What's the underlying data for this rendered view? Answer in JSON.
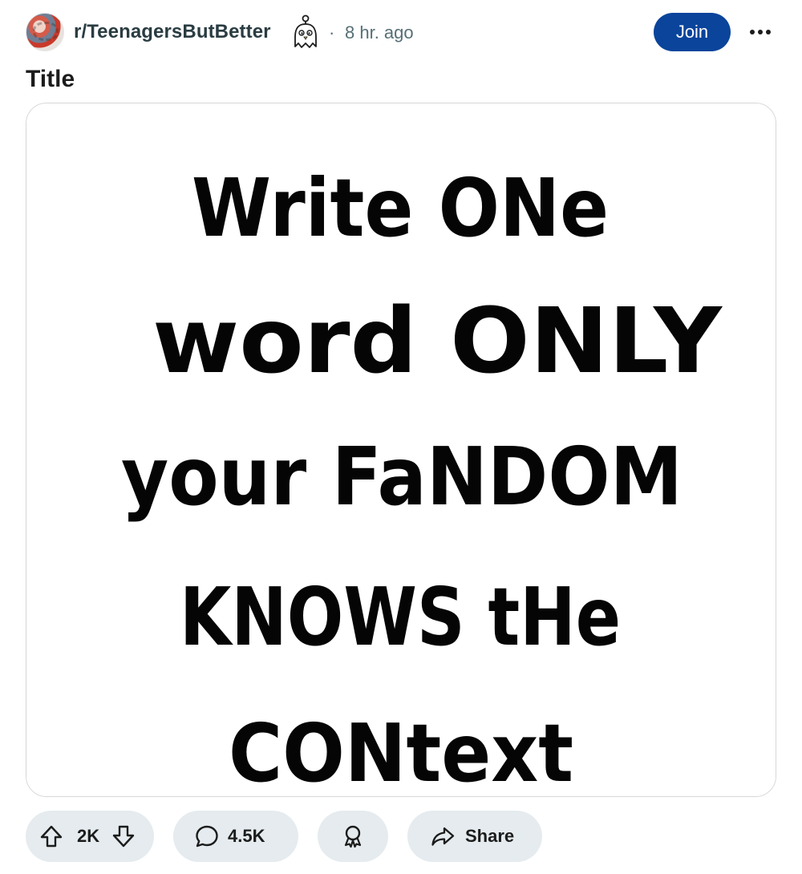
{
  "post": {
    "subreddit": "r/TeenagersButBetter",
    "separator": "·",
    "time_ago": "8 hr. ago",
    "join_label": "Join",
    "title": "Title"
  },
  "image": {
    "lines": [
      "Write ONe",
      "word ONLY",
      "your FaNDOM",
      "KNOWS tHe",
      "CONtext"
    ]
  },
  "actions": {
    "votes": "2K",
    "comments": "4.5K",
    "share_label": "Share"
  },
  "colors": {
    "join_button": "#0a449b",
    "pill_background": "#e5ebee",
    "meta_text": "#576f76"
  }
}
